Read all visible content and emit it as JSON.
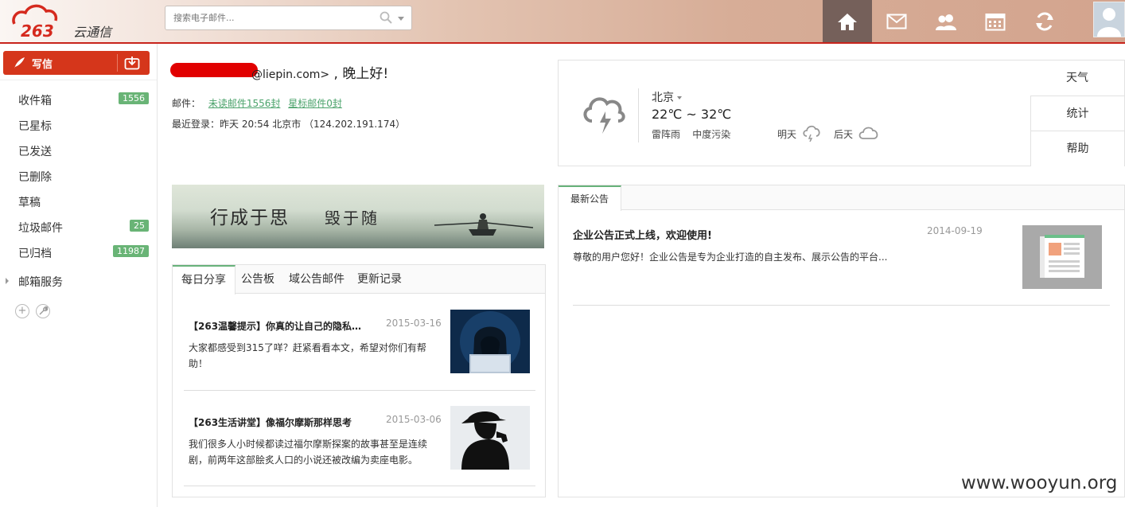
{
  "header": {
    "logo_text": "263云通信",
    "search_placeholder": "搜索电子邮件...",
    "nav_icons": [
      "home-icon",
      "mail-icon",
      "contacts-icon",
      "calendar-icon",
      "sync-icon"
    ]
  },
  "sidebar": {
    "compose_label": "写信",
    "folders": [
      {
        "label": "收件箱",
        "count": "1556"
      },
      {
        "label": "已星标",
        "count": ""
      },
      {
        "label": "已发送",
        "count": ""
      },
      {
        "label": "已删除",
        "count": ""
      },
      {
        "label": "草稿",
        "count": ""
      },
      {
        "label": "垃圾邮件",
        "count": "25"
      },
      {
        "label": "已归档",
        "count": "11987"
      }
    ],
    "service_label": "邮箱服务"
  },
  "greeting": {
    "email_suffix": "@liepin.com>",
    "salutation": " , 晚上好!",
    "mail_label": "邮件：",
    "unread_link": "未读邮件1556封",
    "starred_link": "星标邮件0封",
    "last_login": "最近登录：昨天 20:54 北京市 （124.202.191.174）"
  },
  "weather": {
    "city": "北京",
    "temp": "22℃ ~ 32℃",
    "condition": "雷阵雨",
    "pollution": "中度污染",
    "tomorrow": "明天",
    "day_after": "后天",
    "tabs": [
      "天气",
      "统计",
      "帮助"
    ]
  },
  "banner": {
    "text1": "行成于思",
    "text2": "毁于随"
  },
  "left_card": {
    "tabs": [
      "每日分享",
      "公告板",
      "域公告邮件",
      "更新记录"
    ],
    "articles": [
      {
        "title": "【263温馨提示】你真的让自己的隐私…",
        "date": "2015-03-16",
        "body": "大家都感受到315了咩？赶紧看看本文，希望对你们有帮助！"
      },
      {
        "title": "【263生活讲堂】像福尔摩斯那样思考",
        "date": "2015-03-06",
        "body": "我们很多人小时候都读过福尔摩斯探案的故事甚至是连续剧，前两年这部脍炙人口的小说还被改编为卖座电影。"
      }
    ]
  },
  "right_card": {
    "tab": "最新公告",
    "notice_title": "企业公告正式上线，欢迎使用!",
    "notice_date": "2014-09-19",
    "notice_body": "尊敬的用户您好！企业公告是专为企业打造的自主发布、展示公告的平台..."
  },
  "watermark": "www.wooyun.org"
}
